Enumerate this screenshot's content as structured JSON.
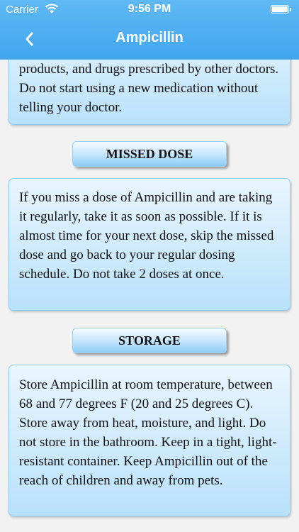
{
  "status_bar": {
    "carrier": "Carrier",
    "time": "9:56 PM",
    "battery_level": 1.0
  },
  "nav": {
    "title": "Ampicillin",
    "back_icon": "chevron-left-icon"
  },
  "sections": {
    "interactions_tail": "products, and drugs prescribed by other doctors. Do not start using a new medication without telling your doctor.",
    "missed_dose": {
      "heading": "MISSED DOSE",
      "body": "If you miss a dose of Ampicillin and are taking it regularly, take it as soon as possible. If it is almost time for your next dose, skip the missed dose and go back to your regular dosing schedule. Do not take 2 doses at once."
    },
    "storage": {
      "heading": "STORAGE",
      "body": "Store Ampicillin at room temperature, between 68 and 77 degrees F (20 and 25 degrees C). Store away from heat, moisture, and light. Do not store in the bathroom. Keep in a tight, light-resistant container. Keep Ampicillin out of the reach of children and away from pets."
    }
  },
  "colors": {
    "nav_blue": "#4aaef1",
    "card_top": "#e9f6ff",
    "card_bottom": "#b9e1fb"
  }
}
